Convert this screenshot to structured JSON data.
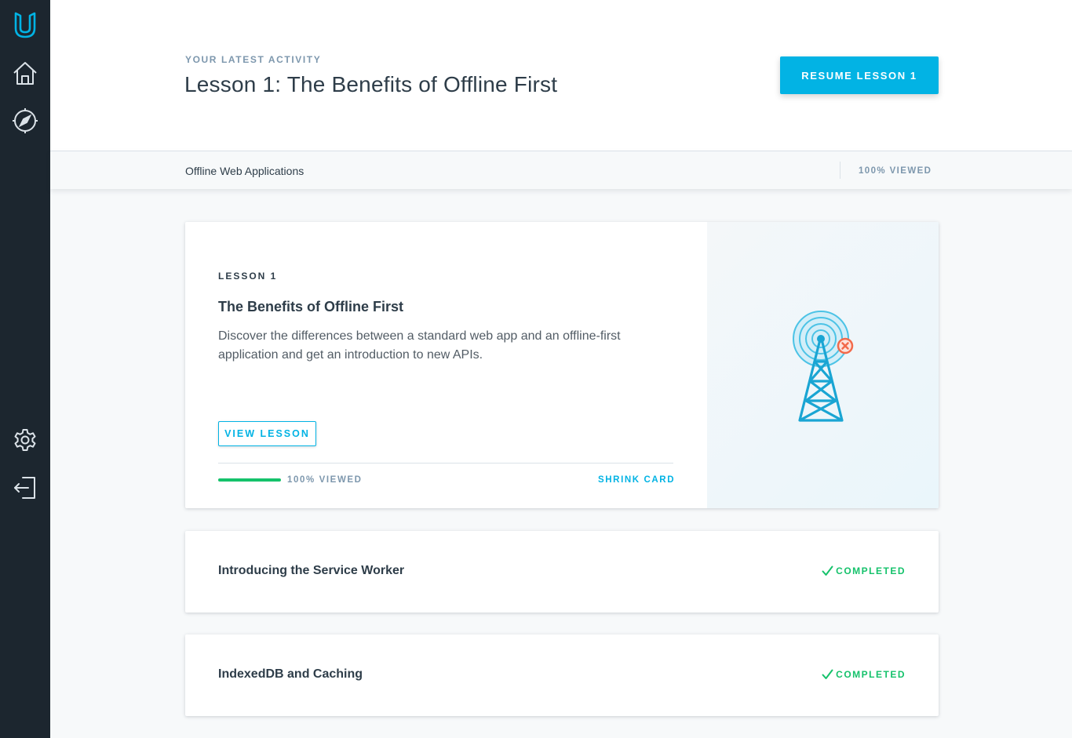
{
  "sidebar": {
    "logo_icon": "udacity-logo-icon",
    "items": [
      {
        "name": "home",
        "icon": "home-icon"
      },
      {
        "name": "explore",
        "icon": "compass-icon"
      },
      {
        "name": "settings",
        "icon": "gear-icon"
      },
      {
        "name": "logout",
        "icon": "logout-icon"
      }
    ]
  },
  "header": {
    "eyebrow": "YOUR LATEST ACTIVITY",
    "title": "Lesson 1: The Benefits of Offline First",
    "resume_label": "RESUME LESSON 1"
  },
  "subbar": {
    "course_name": "Offline Web Applications",
    "viewed": "100% VIEWED"
  },
  "lesson_card": {
    "number": "LESSON 1",
    "title": "The Benefits of Offline First",
    "description": "Discover the differences between a standard web app and an offline-first application and get an introduction to new APIs.",
    "view_label": "VIEW LESSON",
    "progress": 1.0,
    "viewed": "100% VIEWED",
    "shrink_label": "SHRINK CARD",
    "illustration_icon": "radio-tower-offline-icon"
  },
  "lessons": [
    {
      "title": "Introducing the Service Worker",
      "status": "COMPLETED",
      "status_icon": "checkmark-icon"
    },
    {
      "title": "IndexedDB and Caching",
      "status": "COMPLETED",
      "status_icon": "checkmark-icon"
    }
  ],
  "colors": {
    "sidebar_bg": "#1c262f",
    "accent": "#02b3e4",
    "success": "#15c26b",
    "text_primary": "#2e3d49",
    "text_muted": "#7d97ad"
  }
}
